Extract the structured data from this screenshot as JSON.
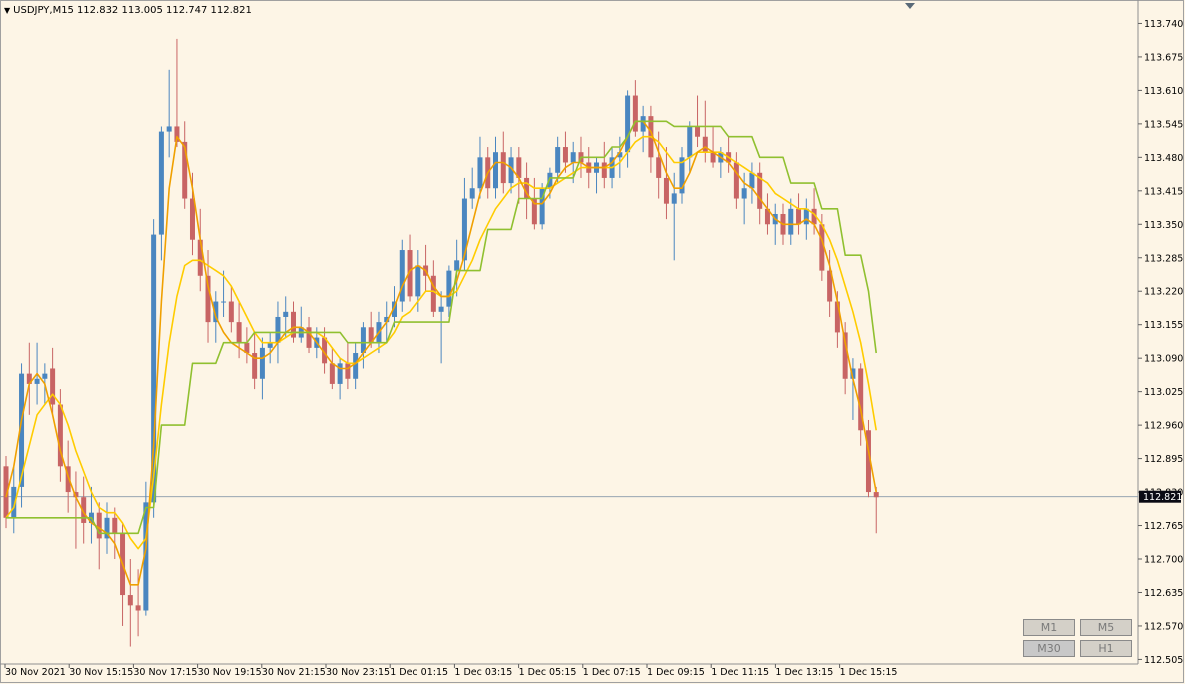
{
  "header": {
    "symbol": "USDJPY,M15",
    "ohlc": "112.832 113.005 112.747 112.821"
  },
  "timeframes": [
    "M1",
    "M5",
    "M30",
    "H1"
  ],
  "colors": {
    "background": "#fdf5e6",
    "bull": "#4a86c0",
    "bear": "#c86464",
    "fast_line": "#ffcc00",
    "smooth_line": "#f0a000",
    "stop_line": "#90c030",
    "price_line": "#8899aa"
  },
  "chart_data": {
    "type": "candlestick",
    "symbol": "USDJPY",
    "timeframe": "M15",
    "ylim": [
      112.5,
      113.77
    ],
    "y_ticks": [
      "113.740",
      "113.675",
      "113.610",
      "113.545",
      "113.480",
      "113.415",
      "113.350",
      "113.285",
      "113.220",
      "113.155",
      "113.090",
      "113.025",
      "112.960",
      "112.895",
      "112.830",
      "112.765",
      "112.700",
      "112.635",
      "112.570",
      "112.505"
    ],
    "x_ticks": [
      "30 Nov 2021",
      "30 Nov 15:15",
      "30 Nov 17:15",
      "30 Nov 19:15",
      "30 Nov 21:15",
      "30 Nov 23:15",
      "1 Dec 01:15",
      "1 Dec 03:15",
      "1 Dec 05:15",
      "1 Dec 07:15",
      "1 Dec 09:15",
      "1 Dec 11:15",
      "1 Dec 13:15",
      "1 Dec 15:15"
    ],
    "current_price": "112.821",
    "candles": [
      [
        112.88,
        112.9,
        112.76,
        112.78
      ],
      [
        112.78,
        112.88,
        112.75,
        112.84
      ],
      [
        112.84,
        113.08,
        112.8,
        113.06
      ],
      [
        113.06,
        113.12,
        112.98,
        113.04
      ],
      [
        113.04,
        113.12,
        113.0,
        113.05
      ],
      [
        113.05,
        113.08,
        113.0,
        113.06
      ],
      [
        113.07,
        113.11,
        112.98,
        113.0
      ],
      [
        113.0,
        113.03,
        112.85,
        112.88
      ],
      [
        112.88,
        112.93,
        112.79,
        112.83
      ],
      [
        112.83,
        112.87,
        112.72,
        112.82
      ],
      [
        112.82,
        112.86,
        112.73,
        112.77
      ],
      [
        112.77,
        112.84,
        112.73,
        112.79
      ],
      [
        112.79,
        112.81,
        112.68,
        112.74
      ],
      [
        112.74,
        112.81,
        112.71,
        112.78
      ],
      [
        112.78,
        112.8,
        112.7,
        112.75
      ],
      [
        112.75,
        112.77,
        112.57,
        112.63
      ],
      [
        112.63,
        112.7,
        112.53,
        112.61
      ],
      [
        112.61,
        112.68,
        112.55,
        112.6
      ],
      [
        112.6,
        112.85,
        112.59,
        112.81
      ],
      [
        112.81,
        113.36,
        112.78,
        113.33
      ],
      [
        113.33,
        113.54,
        113.28,
        113.53
      ],
      [
        113.53,
        113.65,
        113.48,
        113.54
      ],
      [
        113.54,
        113.71,
        113.5,
        113.51
      ],
      [
        113.51,
        113.55,
        113.38,
        113.4
      ],
      [
        113.4,
        113.45,
        113.29,
        113.32
      ],
      [
        113.32,
        113.38,
        113.22,
        113.25
      ],
      [
        113.25,
        113.3,
        113.12,
        113.16
      ],
      [
        113.16,
        113.22,
        113.12,
        113.2
      ],
      [
        113.2,
        113.26,
        113.17,
        113.2
      ],
      [
        113.2,
        113.23,
        113.14,
        113.16
      ],
      [
        113.16,
        113.2,
        113.09,
        113.12
      ],
      [
        113.12,
        113.15,
        113.08,
        113.1
      ],
      [
        113.1,
        113.14,
        113.03,
        113.05
      ],
      [
        113.05,
        113.13,
        113.01,
        113.11
      ],
      [
        113.11,
        113.14,
        113.08,
        113.12
      ],
      [
        113.12,
        113.2,
        113.08,
        113.17
      ],
      [
        113.17,
        113.21,
        113.13,
        113.18
      ],
      [
        113.18,
        113.2,
        113.12,
        113.13
      ],
      [
        113.13,
        113.19,
        113.12,
        113.15
      ],
      [
        113.15,
        113.17,
        113.1,
        113.11
      ],
      [
        113.11,
        113.15,
        113.09,
        113.13
      ],
      [
        113.13,
        113.15,
        113.06,
        113.08
      ],
      [
        113.08,
        113.11,
        113.03,
        113.04
      ],
      [
        113.04,
        113.09,
        113.01,
        113.08
      ],
      [
        113.08,
        113.12,
        113.03,
        113.05
      ],
      [
        113.05,
        113.12,
        113.03,
        113.1
      ],
      [
        113.1,
        113.16,
        113.07,
        113.15
      ],
      [
        113.15,
        113.18,
        113.11,
        113.12
      ],
      [
        113.12,
        113.18,
        113.1,
        113.16
      ],
      [
        113.16,
        113.2,
        113.12,
        113.17
      ],
      [
        113.17,
        113.23,
        113.15,
        113.2
      ],
      [
        113.2,
        113.32,
        113.18,
        113.3
      ],
      [
        113.3,
        113.33,
        113.2,
        113.21
      ],
      [
        113.21,
        113.3,
        113.18,
        113.27
      ],
      [
        113.27,
        113.31,
        113.22,
        113.25
      ],
      [
        113.25,
        113.28,
        113.17,
        113.18
      ],
      [
        113.18,
        113.22,
        113.08,
        113.19
      ],
      [
        113.19,
        113.27,
        113.17,
        113.26
      ],
      [
        113.26,
        113.32,
        113.21,
        113.28
      ],
      [
        113.28,
        113.44,
        113.26,
        113.4
      ],
      [
        113.4,
        113.46,
        113.38,
        113.42
      ],
      [
        113.42,
        113.52,
        113.4,
        113.48
      ],
      [
        113.48,
        113.5,
        113.4,
        113.42
      ],
      [
        113.42,
        113.52,
        113.4,
        113.49
      ],
      [
        113.49,
        113.53,
        113.41,
        113.43
      ],
      [
        113.43,
        113.5,
        113.41,
        113.48
      ],
      [
        113.48,
        113.5,
        113.39,
        113.44
      ],
      [
        113.44,
        113.47,
        113.36,
        113.4
      ],
      [
        113.4,
        113.44,
        113.34,
        113.35
      ],
      [
        113.35,
        113.43,
        113.34,
        113.42
      ],
      [
        113.42,
        113.46,
        113.4,
        113.45
      ],
      [
        113.45,
        113.52,
        113.43,
        113.5
      ],
      [
        113.5,
        113.53,
        113.45,
        113.47
      ],
      [
        113.47,
        113.51,
        113.43,
        113.49
      ],
      [
        113.49,
        113.52,
        113.44,
        113.47
      ],
      [
        113.47,
        113.5,
        113.42,
        113.45
      ],
      [
        113.45,
        113.48,
        113.41,
        113.47
      ],
      [
        113.47,
        113.51,
        113.42,
        113.44
      ],
      [
        113.44,
        113.5,
        113.42,
        113.48
      ],
      [
        113.48,
        113.52,
        113.44,
        113.49
      ],
      [
        113.49,
        113.61,
        113.46,
        113.6
      ],
      [
        113.6,
        113.63,
        113.52,
        113.53
      ],
      [
        113.53,
        113.58,
        113.49,
        113.56
      ],
      [
        113.56,
        113.58,
        113.45,
        113.48
      ],
      [
        113.48,
        113.53,
        113.4,
        113.44
      ],
      [
        113.44,
        113.5,
        113.36,
        113.39
      ],
      [
        113.39,
        113.45,
        113.28,
        113.41
      ],
      [
        113.41,
        113.5,
        113.39,
        113.48
      ],
      [
        113.48,
        113.55,
        113.45,
        113.54
      ],
      [
        113.54,
        113.6,
        113.5,
        113.52
      ],
      [
        113.52,
        113.59,
        113.47,
        113.49
      ],
      [
        113.49,
        113.54,
        113.46,
        113.47
      ],
      [
        113.47,
        113.5,
        113.44,
        113.49
      ],
      [
        113.49,
        113.52,
        113.45,
        113.47
      ],
      [
        113.47,
        113.49,
        113.38,
        113.4
      ],
      [
        113.4,
        113.45,
        113.35,
        113.42
      ],
      [
        113.42,
        113.47,
        113.39,
        113.45
      ],
      [
        113.45,
        113.47,
        113.35,
        113.38
      ],
      [
        113.38,
        113.41,
        113.33,
        113.35
      ],
      [
        113.35,
        113.39,
        113.31,
        113.37
      ],
      [
        113.37,
        113.39,
        113.31,
        113.33
      ],
      [
        113.33,
        113.4,
        113.31,
        113.38
      ],
      [
        113.38,
        113.41,
        113.33,
        113.35
      ],
      [
        113.35,
        113.4,
        113.32,
        113.38
      ],
      [
        113.38,
        113.42,
        113.33,
        113.35
      ],
      [
        113.35,
        113.37,
        113.24,
        113.26
      ],
      [
        113.26,
        113.3,
        113.17,
        113.2
      ],
      [
        113.2,
        113.22,
        113.11,
        113.14
      ],
      [
        113.14,
        113.16,
        113.02,
        113.05
      ],
      [
        113.05,
        113.09,
        112.97,
        113.07
      ],
      [
        113.07,
        113.08,
        112.92,
        112.95
      ],
      [
        112.95,
        112.97,
        112.82,
        112.83
      ],
      [
        112.83,
        112.84,
        112.75,
        112.82
      ]
    ],
    "series": [
      {
        "name": "",
        "style": "fast",
        "values": [
          112.78,
          112.8,
          112.86,
          112.92,
          112.98,
          113.0,
          113.02,
          113.0,
          112.96,
          112.91,
          112.87,
          112.83,
          112.8,
          112.79,
          112.79,
          112.77,
          112.74,
          112.72,
          112.74,
          112.86,
          113.0,
          113.12,
          113.21,
          113.27,
          113.28,
          113.28,
          113.27,
          113.26,
          113.25,
          113.23,
          113.2,
          113.17,
          113.14,
          113.12,
          113.12,
          113.12,
          113.13,
          113.14,
          113.14,
          113.14,
          113.14,
          113.13,
          113.11,
          113.09,
          113.08,
          113.08,
          113.09,
          113.1,
          113.11,
          113.12,
          113.14,
          113.17,
          113.18,
          113.2,
          113.22,
          113.22,
          113.21,
          113.21,
          113.22,
          113.25,
          113.28,
          113.32,
          113.35,
          113.38,
          113.4,
          113.42,
          113.43,
          113.43,
          113.42,
          113.42,
          113.42,
          113.43,
          113.44,
          113.45,
          113.46,
          113.46,
          113.46,
          113.46,
          113.46,
          113.47,
          113.49,
          113.51,
          113.52,
          113.52,
          113.51,
          113.49,
          113.47,
          113.47,
          113.48,
          113.49,
          113.49,
          113.49,
          113.49,
          113.48,
          113.47,
          113.46,
          113.45,
          113.44,
          113.43,
          113.41,
          113.4,
          113.39,
          113.38,
          113.38,
          113.37,
          113.35,
          113.32,
          113.28,
          113.23,
          113.18,
          113.12,
          113.04,
          112.95
        ]
      },
      {
        "name": "",
        "style": "smooth",
        "values": [
          112.82,
          112.88,
          112.97,
          113.04,
          113.06,
          113.04,
          112.98,
          112.91,
          112.86,
          112.82,
          112.79,
          112.77,
          112.76,
          112.75,
          112.73,
          112.69,
          112.65,
          112.65,
          112.72,
          112.92,
          113.2,
          113.42,
          113.52,
          113.5,
          113.42,
          113.32,
          113.23,
          113.17,
          113.14,
          113.12,
          113.11,
          113.1,
          113.09,
          113.09,
          113.1,
          113.12,
          113.14,
          113.15,
          113.15,
          113.14,
          113.12,
          113.1,
          113.08,
          113.07,
          113.07,
          113.08,
          113.1,
          113.12,
          113.14,
          113.16,
          113.19,
          113.23,
          113.26,
          113.27,
          113.26,
          113.23,
          113.21,
          113.21,
          113.24,
          113.29,
          113.35,
          113.41,
          113.45,
          113.47,
          113.47,
          113.46,
          113.44,
          113.41,
          113.39,
          113.39,
          113.41,
          113.44,
          113.46,
          113.47,
          113.47,
          113.46,
          113.46,
          113.46,
          113.47,
          113.49,
          113.52,
          113.55,
          113.55,
          113.53,
          113.49,
          113.45,
          113.42,
          113.42,
          113.45,
          113.49,
          113.5,
          113.49,
          113.48,
          113.47,
          113.45,
          113.43,
          113.42,
          113.4,
          113.38,
          113.36,
          113.35,
          113.35,
          113.35,
          113.36,
          113.35,
          113.32,
          113.27,
          113.2,
          113.12,
          113.05,
          112.99,
          112.91,
          112.83
        ]
      },
      {
        "name": "",
        "style": "stop",
        "values": [
          112.78,
          112.78,
          112.78,
          112.78,
          112.78,
          112.78,
          112.78,
          112.78,
          112.78,
          112.78,
          112.78,
          112.78,
          112.75,
          112.75,
          112.75,
          112.75,
          112.75,
          112.75,
          112.8,
          112.8,
          112.96,
          112.96,
          112.96,
          112.96,
          113.08,
          113.08,
          113.08,
          113.08,
          113.12,
          113.12,
          113.12,
          113.12,
          113.14,
          113.14,
          113.14,
          113.14,
          113.14,
          113.14,
          113.14,
          113.14,
          113.14,
          113.14,
          113.14,
          113.14,
          113.12,
          113.12,
          113.12,
          113.12,
          113.12,
          113.12,
          113.16,
          113.16,
          113.16,
          113.16,
          113.16,
          113.16,
          113.16,
          113.16,
          113.26,
          113.26,
          113.26,
          113.26,
          113.34,
          113.34,
          113.34,
          113.34,
          113.4,
          113.4,
          113.4,
          113.4,
          113.44,
          113.44,
          113.44,
          113.44,
          113.48,
          113.48,
          113.48,
          113.48,
          113.5,
          113.5,
          113.52,
          113.55,
          113.55,
          113.55,
          113.55,
          113.55,
          113.54,
          113.54,
          113.54,
          113.54,
          113.54,
          113.54,
          113.54,
          113.52,
          113.52,
          113.52,
          113.52,
          113.48,
          113.48,
          113.48,
          113.48,
          113.43,
          113.43,
          113.43,
          113.43,
          113.38,
          113.38,
          113.38,
          113.29,
          113.29,
          113.29,
          113.22,
          113.1
        ]
      }
    ]
  }
}
